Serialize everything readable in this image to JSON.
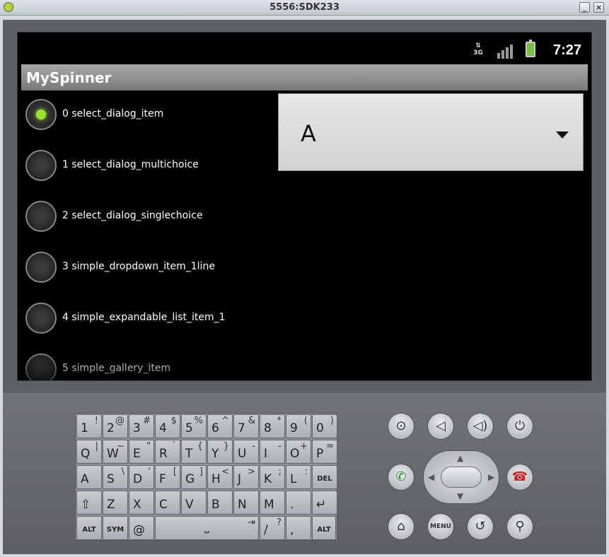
{
  "window": {
    "title": "5556:SDK233",
    "minimize_label": "_",
    "close_label": "×"
  },
  "statusbar": {
    "network": "3G",
    "time": "7:27"
  },
  "app": {
    "title": "MySpinner"
  },
  "radio_items": [
    {
      "label": "0 select_dialog_item",
      "checked": true
    },
    {
      "label": "1 select_dialog_multichoice",
      "checked": false
    },
    {
      "label": "2 select_dialog_singlechoice",
      "checked": false
    },
    {
      "label": "3 simple_dropdown_item_1line",
      "checked": false
    },
    {
      "label": "4 simple_expandable_list_item_1",
      "checked": false
    },
    {
      "label": "5 simple_gallery_item",
      "checked": false
    }
  ],
  "spinner": {
    "value": "A"
  },
  "keyboard": {
    "rows": [
      [
        {
          "m": "1",
          "a": "!"
        },
        {
          "m": "2",
          "a": "@"
        },
        {
          "m": "3",
          "a": "#"
        },
        {
          "m": "4",
          "a": "$"
        },
        {
          "m": "5",
          "a": "%"
        },
        {
          "m": "6",
          "a": "^"
        },
        {
          "m": "7",
          "a": "&"
        },
        {
          "m": "8",
          "a": "*"
        },
        {
          "m": "9",
          "a": "("
        },
        {
          "m": "0",
          "a": ")"
        }
      ],
      [
        {
          "m": "Q",
          "a": "|"
        },
        {
          "m": "W",
          "a": "~"
        },
        {
          "m": "E",
          "a": "\""
        },
        {
          "m": "R",
          "a": "`"
        },
        {
          "m": "T",
          "a": "{"
        },
        {
          "m": "Y",
          "a": "}"
        },
        {
          "m": "U",
          "a": "-"
        },
        {
          "m": "I",
          "a": "-"
        },
        {
          "m": "O",
          "a": "+"
        },
        {
          "m": "P",
          "a": "="
        }
      ],
      [
        {
          "m": "A",
          "a": ""
        },
        {
          "m": "S",
          "a": "\\"
        },
        {
          "m": "D",
          "a": "'"
        },
        {
          "m": "F",
          "a": "["
        },
        {
          "m": "G",
          "a": "]"
        },
        {
          "m": "H",
          "a": "<"
        },
        {
          "m": "J",
          "a": ">"
        },
        {
          "m": "K",
          "a": ";"
        },
        {
          "m": "L",
          "a": ":"
        },
        {
          "m": "DEL",
          "a": ""
        }
      ],
      [
        {
          "m": "⇧",
          "a": ""
        },
        {
          "m": "Z",
          "a": ""
        },
        {
          "m": "X",
          "a": ""
        },
        {
          "m": "C",
          "a": ""
        },
        {
          "m": "V",
          "a": ""
        },
        {
          "m": "B",
          "a": ""
        },
        {
          "m": "N",
          "a": ""
        },
        {
          "m": "M",
          "a": ""
        },
        {
          "m": ".",
          "a": ""
        },
        {
          "m": "↵",
          "a": ""
        }
      ]
    ],
    "bottom": {
      "alt_left": "ALT",
      "sym": "SYM",
      "at": "@",
      "space": "␣",
      "tab": "⇥",
      "slash": "/",
      "question": "?",
      "comma": ",",
      "alt_right": "ALT"
    }
  },
  "controls": {
    "camera": "camera-icon",
    "vol_down": "volume-down-icon",
    "vol_up": "volume-up-icon",
    "power": "power-icon",
    "call": "call-icon",
    "end_call": "end-call-icon",
    "home": "home-icon",
    "menu_label": "MENU",
    "back": "back-icon",
    "search": "search-icon"
  }
}
